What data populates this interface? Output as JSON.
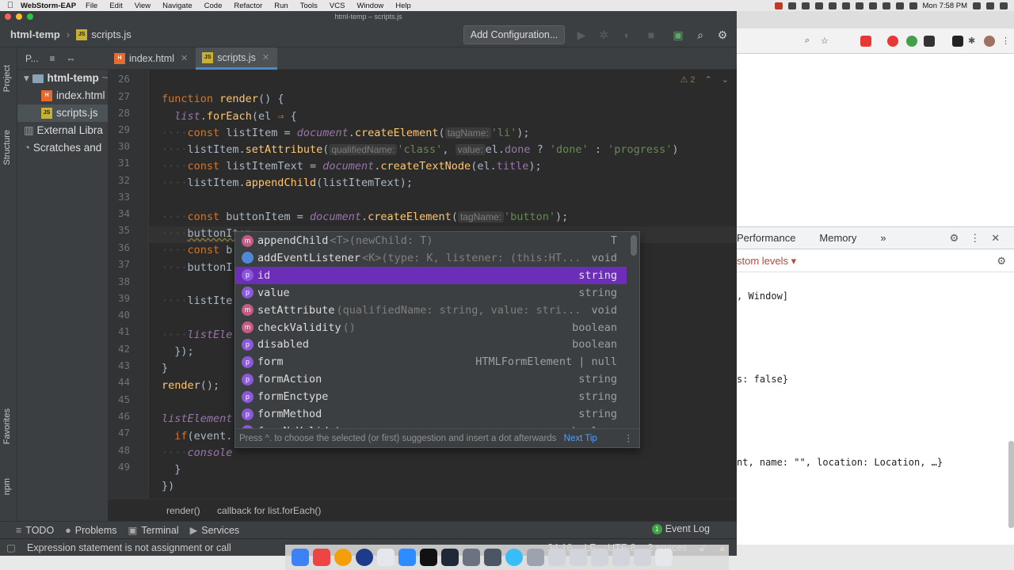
{
  "menubar": {
    "app": "WebStorm-EAP",
    "items": [
      "File",
      "Edit",
      "View",
      "Navigate",
      "Code",
      "Refactor",
      "Run",
      "Tools",
      "VCS",
      "Window",
      "Help"
    ],
    "clock": "Mon 7:58 PM"
  },
  "window": {
    "title": "html-temp – scripts.js"
  },
  "navbar": {
    "project": "html-temp",
    "file": "scripts.js",
    "add_configuration": "Add Configuration..."
  },
  "left_strip": {
    "project": "Project",
    "structure": "Structure",
    "favorites": "Favorites",
    "npm": "npm"
  },
  "project_panel": {
    "header": "P...",
    "root": "html-temp",
    "root_suffix": "~/",
    "files": [
      "index.html",
      "scripts.js"
    ],
    "external": "External Libra",
    "scratches": "Scratches and"
  },
  "tabs": [
    {
      "label": "index.html"
    },
    {
      "label": "scripts.js"
    }
  ],
  "editor": {
    "warnings": "⚠ 2",
    "line_numbers": [
      "26",
      "27",
      "28",
      "29",
      "30",
      "31",
      "32",
      "33",
      "34",
      "35",
      "36",
      "37",
      "38",
      "39",
      "40",
      "41",
      "42",
      "43",
      "44",
      "45",
      "46",
      "47",
      "48",
      "49"
    ]
  },
  "completion": {
    "items": [
      {
        "kind": "m",
        "name": "appendChild",
        "sig": "<T>(newChild: T)",
        "type": "T"
      },
      {
        "kind": "f",
        "name": "addEventListener",
        "sig": "<K>(type: K, listener: (this:HT...",
        "type": "void"
      },
      {
        "kind": "p",
        "name": "id",
        "sig": "",
        "type": "string"
      },
      {
        "kind": "p",
        "name": "value",
        "sig": "",
        "type": "string"
      },
      {
        "kind": "m",
        "name": "setAttribute",
        "sig": "(qualifiedName: string, value: stri...",
        "type": "void"
      },
      {
        "kind": "m",
        "name": "checkValidity",
        "sig": "()",
        "type": "boolean"
      },
      {
        "kind": "p",
        "name": "disabled",
        "sig": "",
        "type": "boolean"
      },
      {
        "kind": "p",
        "name": "form",
        "sig": "",
        "type": "HTMLFormElement | null"
      },
      {
        "kind": "p",
        "name": "formAction",
        "sig": "",
        "type": "string"
      },
      {
        "kind": "p",
        "name": "formEnctype",
        "sig": "",
        "type": "string"
      },
      {
        "kind": "p",
        "name": "formMethod",
        "sig": "",
        "type": "string"
      },
      {
        "kind": "p",
        "name": "formNoValidate",
        "sig": "",
        "type": "boolean"
      }
    ],
    "selected_index": 2,
    "footer": "Press ^. to choose the selected (or first) suggestion and insert a dot afterwards",
    "next_tip": "Next Tip"
  },
  "breadcrumbs": [
    "render()",
    "callback for list.forEach()"
  ],
  "bottom_tools": {
    "todo": "TODO",
    "problems": "Problems",
    "terminal": "Terminal",
    "services": "Services",
    "event_log": "Event Log"
  },
  "status": {
    "message": "Expression statement is not assignment or call",
    "position": "34:16",
    "line_sep": "LF",
    "encoding": "UTF-8",
    "indent": "2 spaces"
  },
  "devtools": {
    "tabs": [
      "Performance",
      "Memory"
    ],
    "levels": "stom levels ▾",
    "console": [
      ", Window]",
      "s: false}",
      "nt, name: \"\", location: Location, …}"
    ]
  }
}
